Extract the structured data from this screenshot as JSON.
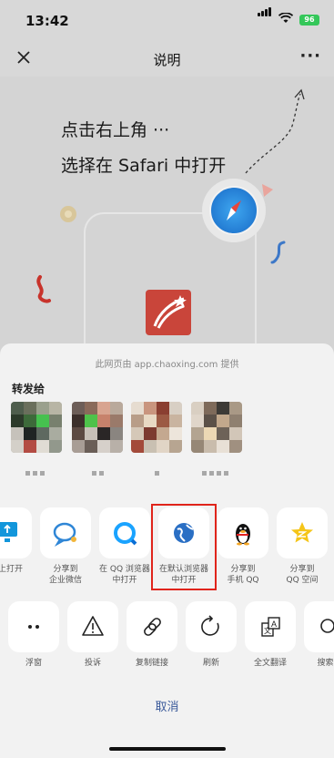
{
  "status": {
    "time": "13:42",
    "battery": "96"
  },
  "nav": {
    "title": "说明",
    "more": "···"
  },
  "instructions": {
    "line1": "点击右上角 ···",
    "line2": "选择在 Safari 中打开"
  },
  "sheet": {
    "provider": "此网页由 app.chaoxing.com 提供",
    "forward_title": "转发给",
    "actions_row1": [
      {
        "label_l1": "顶上打开",
        "label_l2": "",
        "icon": "monitor-icon"
      },
      {
        "label_l1": "分享到",
        "label_l2": "企业微信",
        "icon": "wecom-icon"
      },
      {
        "label_l1": "在 QQ 浏览器",
        "label_l2": "中打开",
        "icon": "qq-browser-icon"
      },
      {
        "label_l1": "在默认浏览器",
        "label_l2": "中打开",
        "icon": "globe-icon"
      },
      {
        "label_l1": "分享到",
        "label_l2": "手机 QQ",
        "icon": "qq-penguin-icon"
      },
      {
        "label_l1": "分享到",
        "label_l2": "QQ 空间",
        "icon": "qzone-star-icon"
      }
    ],
    "actions_row2": [
      {
        "label": "浮窗",
        "icon": "float-window-icon"
      },
      {
        "label": "投诉",
        "icon": "warning-icon"
      },
      {
        "label": "复制链接",
        "icon": "link-icon"
      },
      {
        "label": "刷新",
        "icon": "refresh-icon"
      },
      {
        "label": "全文翻译",
        "icon": "translate-icon"
      },
      {
        "label": "搜索页",
        "icon": "search-icon"
      }
    ],
    "cancel": "取消"
  },
  "colors": {
    "highlight": "#e0241b",
    "battery": "#34c759",
    "cancel": "#3b5a9a"
  }
}
